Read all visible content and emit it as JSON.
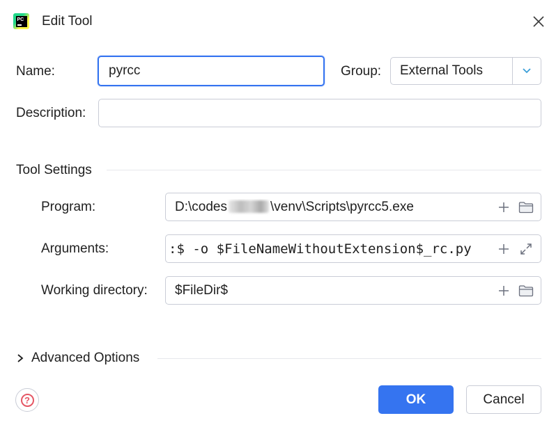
{
  "window": {
    "title": "Edit Tool",
    "app_icon_text": "PC"
  },
  "form": {
    "name_label": "Name:",
    "name_value": "pyrcc",
    "group_label": "Group:",
    "group_value": "External Tools",
    "description_label": "Description:",
    "description_value": ""
  },
  "tool_settings": {
    "section_title": "Tool Settings",
    "program_label": "Program:",
    "program_value_prefix": "D:\\codes",
    "program_value_suffix": "\\venv\\Scripts\\pyrcc5.exe",
    "arguments_label": "Arguments:",
    "arguments_value": ":$ -o $FileNameWithoutExtension$_rc.py",
    "working_dir_label": "Working directory:",
    "working_dir_value": "$FileDir$"
  },
  "advanced": {
    "label": "Advanced Options"
  },
  "buttons": {
    "ok": "OK",
    "cancel": "Cancel",
    "help": "?"
  },
  "colors": {
    "accent": "#3574f0",
    "border": "#c9ccd6",
    "help": "#e55765"
  }
}
